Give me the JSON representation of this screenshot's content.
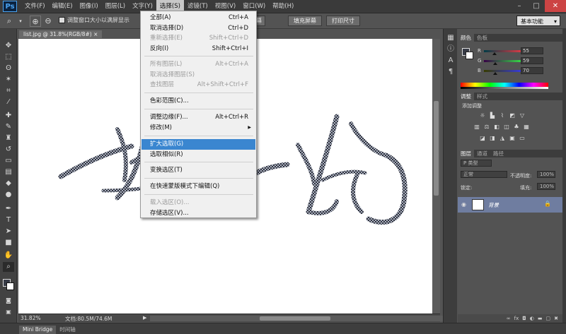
{
  "app": {
    "logo": "Ps"
  },
  "menubar": {
    "items": [
      "文件(F)",
      "编辑(E)",
      "图像(I)",
      "图层(L)",
      "文字(Y)",
      "选择(S)",
      "滤镜(T)",
      "视图(V)",
      "窗口(W)",
      "帮助(H)"
    ],
    "active_index": 5,
    "window_buttons": [
      "–",
      "□",
      "✕"
    ]
  },
  "options": {
    "zoom_all_windows_label": "调整窗口大小以满屏显示",
    "fill_screen_left": "适合屏幕",
    "fill_screen": "填充屏幕",
    "print_size": "打印尺寸",
    "workspace": "基本功能"
  },
  "document": {
    "tab": "list.jpg @ 31.8%(RGB/8#)",
    "tab_close": "×",
    "zoom": "31.82%",
    "info": "文档:80.5M/74.6M",
    "status_arrow": "▶"
  },
  "select_menu": {
    "items": [
      {
        "label": "全部(A)",
        "shortcut": "Ctrl+A",
        "disabled": false
      },
      {
        "label": "取消选择(D)",
        "shortcut": "Ctrl+D",
        "disabled": false
      },
      {
        "label": "重新选择(E)",
        "shortcut": "Shift+Ctrl+D",
        "disabled": true
      },
      {
        "label": "反向(I)",
        "shortcut": "Shift+Ctrl+I",
        "disabled": false
      },
      {
        "label": "所有图层(L)",
        "shortcut": "Alt+Ctrl+A",
        "disabled": true
      },
      {
        "label": "取消选择图层(S)",
        "shortcut": "",
        "disabled": true
      },
      {
        "label": "查找图层",
        "shortcut": "Alt+Shift+Ctrl+F",
        "disabled": true
      },
      {
        "label": "色彩范围(C)...",
        "shortcut": "",
        "disabled": false
      },
      {
        "label": "调整边缘(F)...",
        "shortcut": "Alt+Ctrl+R",
        "disabled": false
      },
      {
        "label": "修改(M)",
        "shortcut": "",
        "disabled": false,
        "submenu": true
      },
      {
        "label": "扩大选取(G)",
        "shortcut": "",
        "disabled": false,
        "highlighted": true
      },
      {
        "label": "选取相似(R)",
        "shortcut": "",
        "disabled": false
      },
      {
        "label": "变换选区(T)",
        "shortcut": "",
        "disabled": false
      },
      {
        "label": "在快速蒙版模式下编辑(Q)",
        "shortcut": "",
        "disabled": false
      },
      {
        "label": "载入选区(O)...",
        "shortcut": "",
        "disabled": true
      },
      {
        "label": "存储选区(V)...",
        "shortcut": "",
        "disabled": false
      }
    ],
    "submenu_arrow": "▶"
  },
  "color_panel": {
    "tabs": [
      "颜色",
      "色板"
    ],
    "r_label": "R",
    "g_label": "G",
    "b_label": "B",
    "r": 55,
    "g": 59,
    "b": 70,
    "foreground": "#373b46",
    "background": "#ffffff"
  },
  "adjustments_panel": {
    "tabs": [
      "调整",
      "样式"
    ],
    "title": "添加调整"
  },
  "layers_panel": {
    "tabs": [
      "图层",
      "通道",
      "路径"
    ],
    "filter": "P 类型",
    "blend": "正常",
    "opacity_label": "不透明度:",
    "opacity": "100%",
    "lock_label": "锁定:",
    "fill_label": "填充:",
    "fill": "100%",
    "layer_name": "背景"
  },
  "bottom": {
    "tabs": [
      "Mini Bridge",
      "时间轴"
    ]
  },
  "colors": {
    "accent": "#3a86d0",
    "ui_dark": "#535353"
  }
}
